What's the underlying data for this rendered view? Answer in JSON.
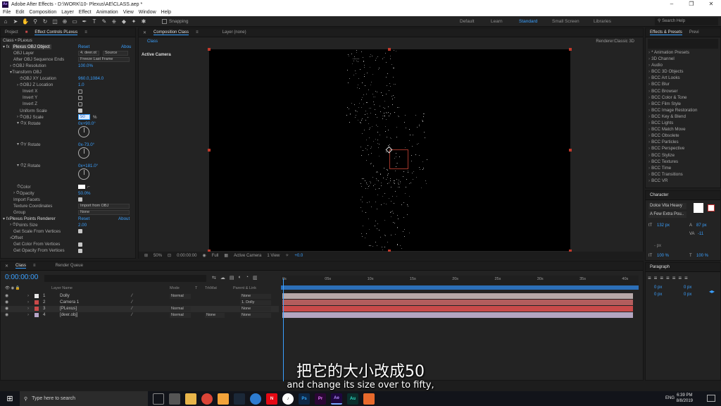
{
  "window": {
    "title": "Adobe After Effects - D:\\WORK\\10- Plexus\\AE\\CLASS.aep *",
    "app_badge": "Ae"
  },
  "menu": [
    "File",
    "Edit",
    "Composition",
    "Layer",
    "Effect",
    "Animation",
    "View",
    "Window",
    "Help"
  ],
  "toolbar": {
    "snapping": "Snapping",
    "workspaces": [
      "Default",
      "Learn",
      "Standard",
      "Small Screen",
      "Libraries"
    ],
    "active_workspace": "Standard",
    "search_placeholder": "Search Help"
  },
  "effect_controls": {
    "tabs": {
      "project": "Project",
      "effect": "Effect Controls PLexus"
    },
    "breadcrumb": "Class • PLexus",
    "effect_name": "Plexus OBJ Object",
    "reset": "Reset",
    "about": "Abou",
    "rows": [
      {
        "label": "OBJ Layer",
        "value": "4. deer.ot",
        "extra": "Source",
        "kind": "select"
      },
      {
        "label": "After OBJ Sequence Ends",
        "value": "Freeze Last Frame",
        "kind": "select"
      },
      {
        "label": "OBJ Resolution",
        "value": "100.0%",
        "kind": "value"
      },
      {
        "label": "Transform OBJ",
        "kind": "header"
      },
      {
        "label": "OBJ XY Location",
        "value": "960.0,1084.0",
        "kind": "value"
      },
      {
        "label": "OBJ Z Location",
        "value": "1.0",
        "kind": "value"
      },
      {
        "label": "Invert X",
        "kind": "check"
      },
      {
        "label": "Invert Y",
        "kind": "check"
      },
      {
        "label": "Invert Z",
        "kind": "check"
      },
      {
        "label": "Uniform Scale",
        "kind": "check"
      },
      {
        "label": "OBJ Scale",
        "value": "50",
        "unit": "%",
        "kind": "editing"
      }
    ],
    "rotations": [
      {
        "label": "X Rotate",
        "value": "0x+90.0°"
      },
      {
        "label": "Y Rotate",
        "value": "0x-73.0°"
      },
      {
        "label": "Z Rotate",
        "value": "0x+181.0°"
      }
    ],
    "rows2": [
      {
        "label": "Color",
        "kind": "color"
      },
      {
        "label": "Opacity",
        "value": "50.0%",
        "kind": "value"
      },
      {
        "label": "Import Facets",
        "kind": "check"
      },
      {
        "label": "Texture Coordinates",
        "value": "Import from OBJ",
        "kind": "select"
      },
      {
        "label": "Group",
        "value": "None",
        "kind": "select"
      }
    ],
    "points_renderer": {
      "name": "Plexus Points Renderer",
      "reset": "Reset",
      "about": "About"
    },
    "rows3": [
      {
        "label": "Points Size",
        "value": "2.00",
        "kind": "value"
      },
      {
        "label": "Get Scale From Vertices",
        "kind": "check"
      },
      {
        "label": "Offset",
        "kind": "header"
      },
      {
        "label": "Get Color From Vertices",
        "kind": "check"
      },
      {
        "label": "Get Opacity From Vertices",
        "kind": "check"
      }
    ]
  },
  "composition": {
    "tab": "Composition Class",
    "layer_tab": "Layer (none)",
    "sub_tab": "Class",
    "active_camera": "Active Camera",
    "renderer_label": "Renderer:",
    "renderer_value": "Classic 3D",
    "bottom": {
      "zoom": "50%",
      "timecode": "0:00:00:00",
      "resolution": "Full",
      "camera": "Active Camera",
      "view": "1 View",
      "exposure": "+0.0"
    }
  },
  "effects_presets": {
    "tabs": [
      "Effects & Presets",
      "Previ"
    ],
    "items": [
      "* Animation Presets",
      "3D Channel",
      "Audio",
      "BCC 3D Objects",
      "BCC Art Looks",
      "BCC Blur",
      "BCC Browser",
      "BCC Color & Tone",
      "BCC Film Style",
      "BCC Image Restoration",
      "BCC Key & Blend",
      "BCC Lights",
      "BCC Match Move",
      "BCC Obsolete",
      "BCC Particles",
      "BCC Perspective",
      "BCC Stylize",
      "BCC Textures",
      "BCC Time",
      "BCC Transitions",
      "BCC VR"
    ]
  },
  "character": {
    "title": "Character",
    "font": "Dolce Vita Heavy",
    "font_style": "A Few Extra Pou..",
    "size": "132 px",
    "leading": "87 px",
    "tracking": "-11",
    "units": "- px",
    "scale_v": "100 %",
    "scale_h": "100 %"
  },
  "paragraph": {
    "title": "Paragraph",
    "indents": [
      "0 px",
      "0 px",
      "0 px",
      "0 px"
    ]
  },
  "timeline": {
    "tabs": {
      "comp": "Class",
      "render": "Render Queue"
    },
    "timecode": "0:00:00:00",
    "columns": [
      "Layer Name",
      "Mode",
      "T",
      "TrkMat",
      "Parent & Link"
    ],
    "ruler": [
      "0s",
      "05s",
      "10s",
      "15s",
      "20s",
      "25s",
      "30s",
      "35s",
      "40s"
    ],
    "layers": [
      {
        "num": "1",
        "name": "Dolly",
        "mode": "Normal",
        "trk": "",
        "parent": "None",
        "color": "#e8e8e8"
      },
      {
        "num": "2",
        "name": "Camera 1",
        "mode": "",
        "trk": "",
        "parent": "1. Dolly",
        "color": "#c94a4a"
      },
      {
        "num": "3",
        "name": "[PLexus]",
        "mode": "Normal",
        "trk": "",
        "parent": "None",
        "color": "#c94a4a"
      },
      {
        "num": "4",
        "name": "[deer.obj]",
        "mode": "Normal",
        "trk": "None",
        "parent": "None",
        "color": "#b6a6c8"
      }
    ]
  },
  "subtitles": {
    "cn": "把它的大小改成50",
    "en": "and change its size over to fifty,"
  },
  "taskbar": {
    "search_placeholder": "Type here to search",
    "apps": [
      "Ps",
      "Pr",
      "Ae",
      "Au"
    ],
    "language": "ENG",
    "time": "6:39 PM",
    "date": "8/8/2019"
  }
}
